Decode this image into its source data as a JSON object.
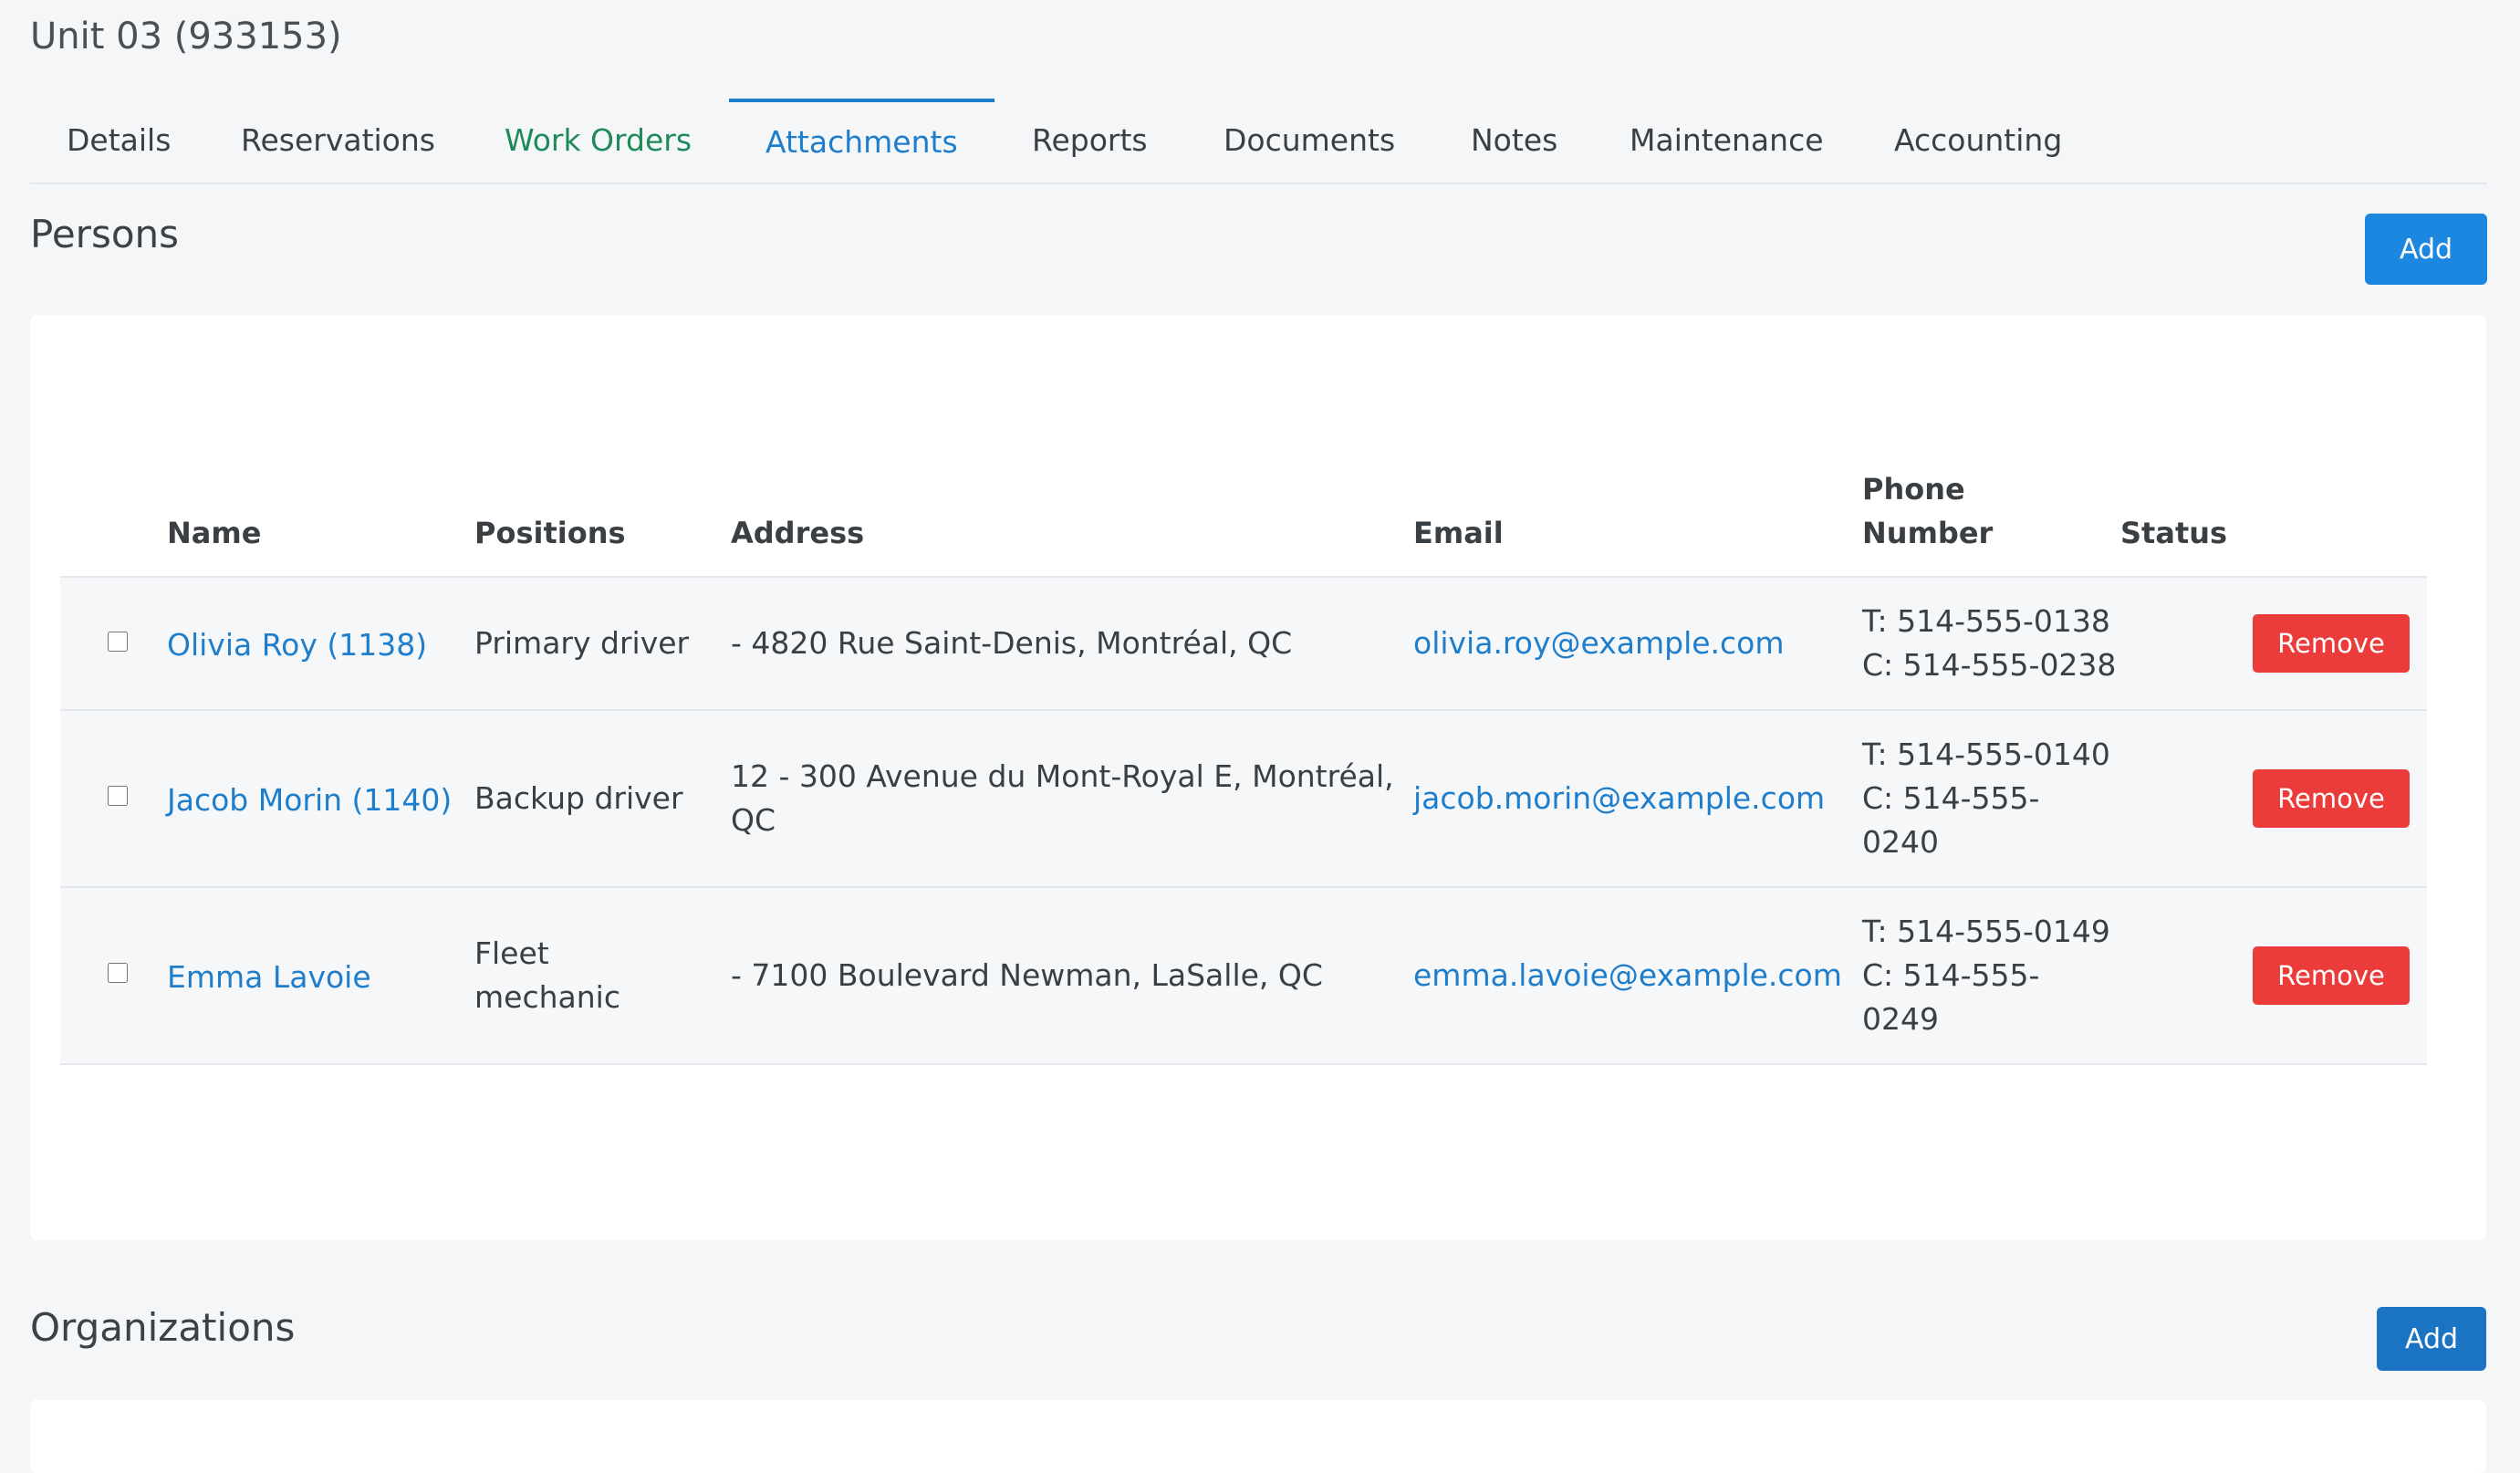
{
  "header": {
    "title": "Unit 03 (933153)"
  },
  "tabs": [
    {
      "label": "Details"
    },
    {
      "label": "Reservations"
    },
    {
      "label": "Work Orders"
    },
    {
      "label": "Attachments"
    },
    {
      "label": "Reports"
    },
    {
      "label": "Documents"
    },
    {
      "label": "Notes"
    },
    {
      "label": "Maintenance"
    },
    {
      "label": "Accounting"
    }
  ],
  "active_tab": "Attachments",
  "persons": {
    "title": "Persons",
    "add_label": "Add",
    "columns": {
      "name": "Name",
      "positions": "Positions",
      "address": "Address",
      "email": "Email",
      "phone_line1": "Phone",
      "phone_line2": "Number",
      "status": "Status"
    },
    "rows": [
      {
        "name": "Olivia Roy (1138)",
        "positions": [
          "Primary driver"
        ],
        "address": [
          "- 4820 Rue Saint-Denis, Montréal, QC"
        ],
        "email": "olivia.roy@example.com",
        "phone": [
          "T: 514-555-0138",
          "C: 514-555-0238"
        ],
        "remove_label": "Remove"
      },
      {
        "name": "Jacob Morin (1140)",
        "positions": [
          "Backup driver"
        ],
        "address": [
          "12 - 300 Avenue du Mont-Royal E, Montréal,",
          "QC"
        ],
        "email": "jacob.morin@example.com",
        "phone": [
          "T: 514-555-0140",
          "C: 514-555-",
          "0240"
        ],
        "remove_label": "Remove"
      },
      {
        "name": "Emma Lavoie",
        "positions": [
          "Fleet",
          "mechanic"
        ],
        "address": [
          "- 7100 Boulevard Newman, LaSalle, QC"
        ],
        "email": "emma.lavoie@example.com",
        "phone": [
          "T: 514-555-0149",
          "C: 514-555-",
          "0249"
        ],
        "remove_label": "Remove"
      }
    ]
  },
  "organizations": {
    "title": "Organizations",
    "add_label": "Add"
  },
  "colors": {
    "accent": "#1f7ecb",
    "active_tab": "#1f7ecb",
    "work_orders_tab": "#1e8a5a",
    "remove_button": "#ec3b3b",
    "add_button": "#1c87e0",
    "page_bg": "#f4f6f8"
  }
}
